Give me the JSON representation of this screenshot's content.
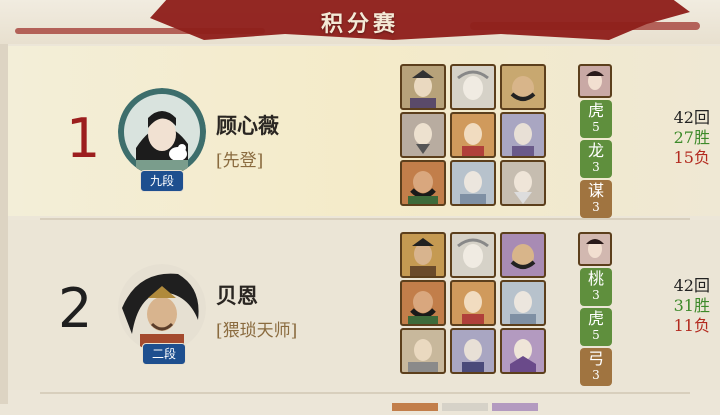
{
  "header": {
    "title": "积分赛"
  },
  "colors": {
    "banner": "#8f1f1b",
    "rank_top": "#9c1e1e",
    "win": "#3d8a2a",
    "loss": "#b32a1f",
    "badge": "#1e4f8f",
    "tag_green": "#5f8f3d",
    "tag_brown": "#a07440"
  },
  "players": [
    {
      "rank": "1",
      "name": "顾心薇",
      "title": "[先登]",
      "level": "九段",
      "tags": [
        {
          "label": "虎",
          "count": "5",
          "color": "green"
        },
        {
          "label": "龙",
          "count": "3",
          "color": "green"
        },
        {
          "label": "谋",
          "count": "3",
          "color": "brown"
        }
      ],
      "total": "42回",
      "wins": "27胜",
      "losses": "15负"
    },
    {
      "rank": "2",
      "name": "贝恩",
      "title": "[猥琐天师]",
      "level": "二段",
      "tags": [
        {
          "label": "桃",
          "count": "3",
          "color": "green"
        },
        {
          "label": "虎",
          "count": "5",
          "color": "green"
        },
        {
          "label": "弓",
          "count": "3",
          "color": "brown"
        }
      ],
      "total": "42回",
      "wins": "31胜",
      "losses": "11负"
    }
  ],
  "icons": {
    "hero_card": "hero-portrait-icon",
    "avatar": "player-avatar-icon"
  }
}
